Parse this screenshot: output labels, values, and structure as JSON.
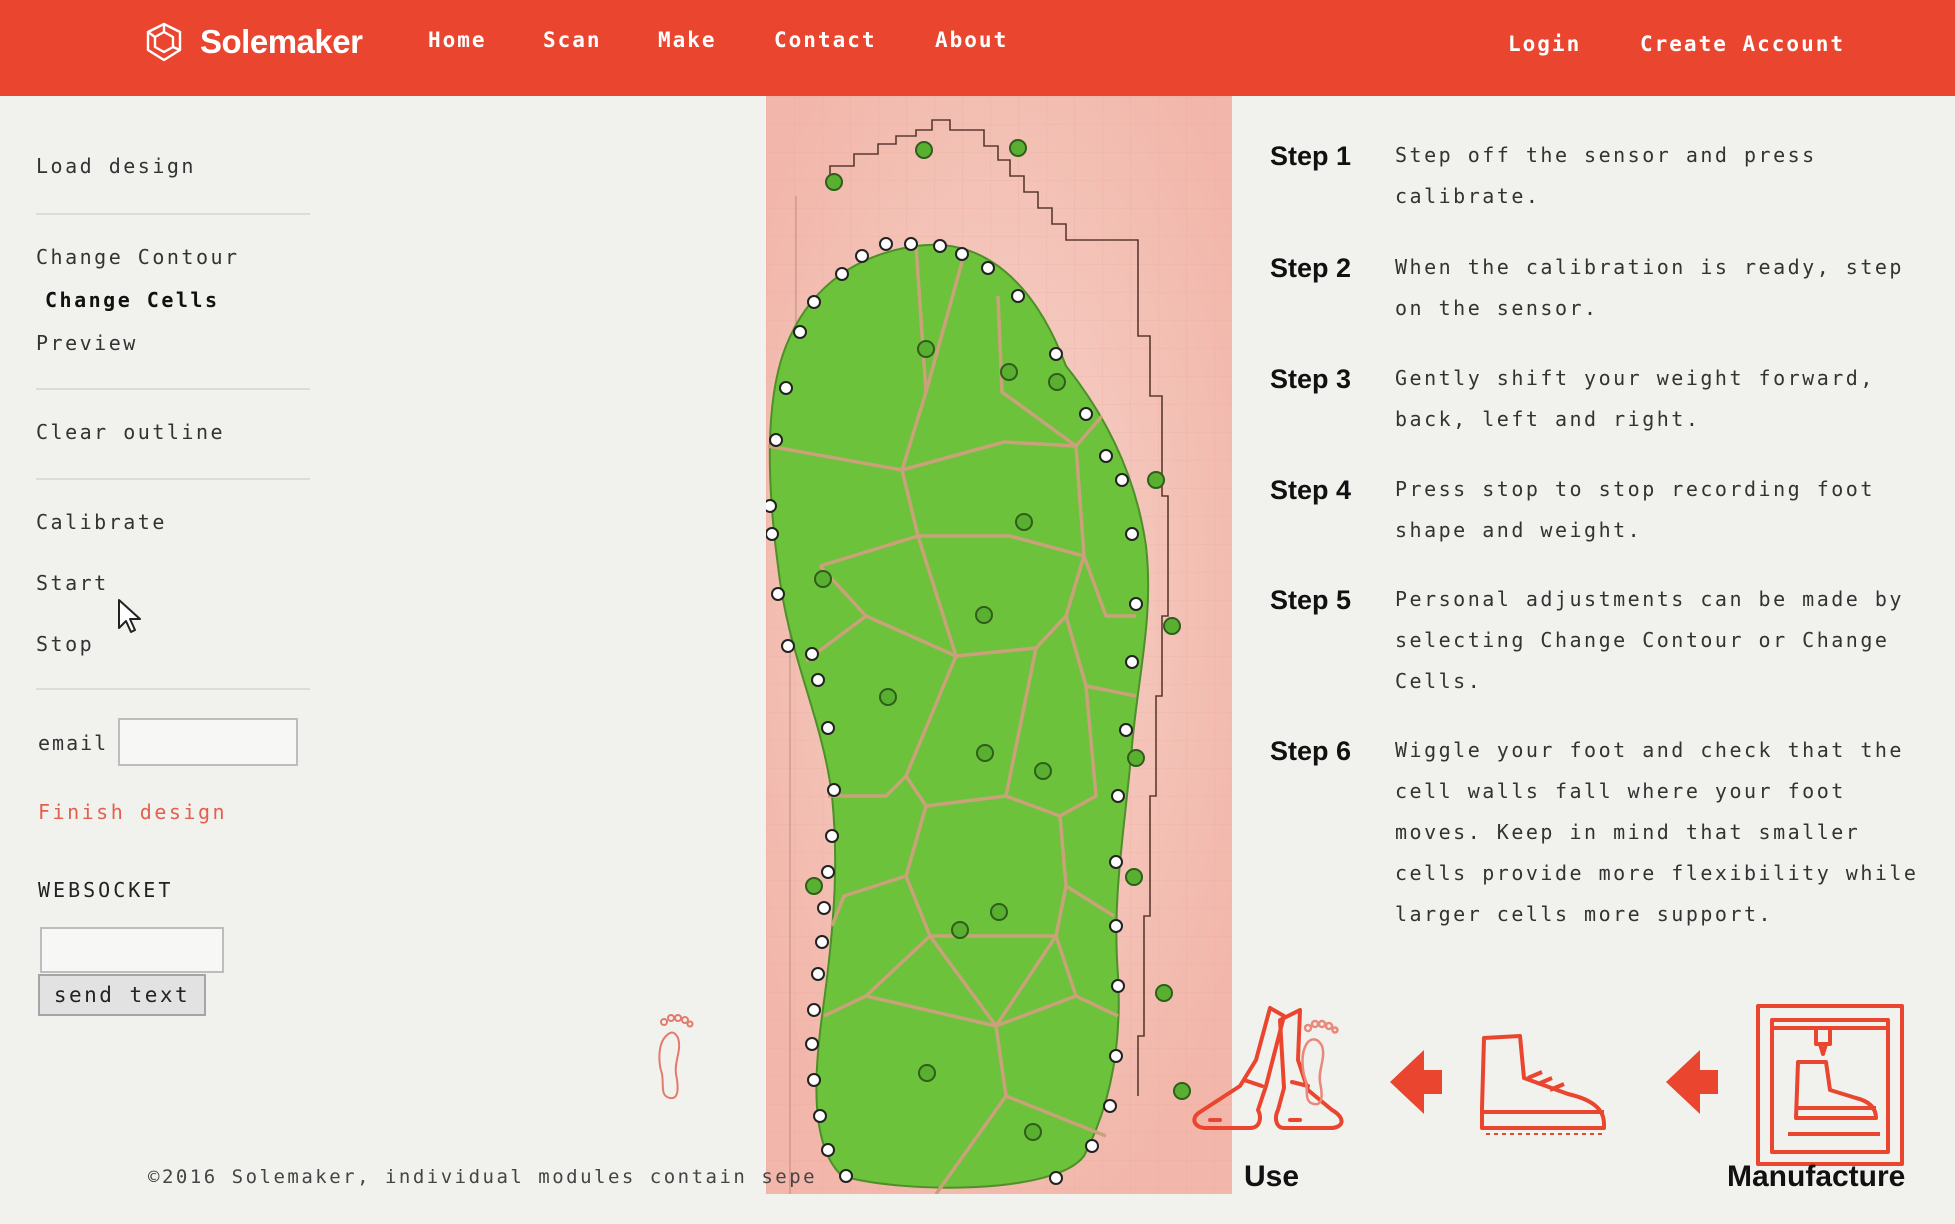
{
  "header": {
    "brand": "Solemaker",
    "nav": [
      "Home",
      "Scan",
      "Make",
      "Contact",
      "About"
    ],
    "auth": [
      "Login",
      "Create Account"
    ]
  },
  "sidebar": {
    "load_design": "Load design",
    "change_contour": "Change Contour",
    "change_cells": "Change Cells",
    "preview": "Preview",
    "clear_outline": "Clear outline",
    "calibrate": "Calibrate",
    "start": "Start",
    "stop": "Stop",
    "email_label": "email",
    "email_value": "",
    "finish_design": "Finish design",
    "websocket_title": "WEBSOCKET",
    "websocket_value": "",
    "send_button": "send text"
  },
  "steps": [
    {
      "label": "Step 1",
      "text": "Step off the sensor and press calibrate."
    },
    {
      "label": "Step 2",
      "text": "When the calibration is ready, step on the sensor."
    },
    {
      "label": "Step 3",
      "text": "Gently shift your weight forward, back, left and right."
    },
    {
      "label": "Step 4",
      "text": "Press stop to stop recording foot shape and weight."
    },
    {
      "label": "Step 5",
      "text": "Personal adjustments can be made by selecting Change Contour or Change Cells."
    },
    {
      "label": "Step 6",
      "text": "Wiggle your foot and check that the cell walls fall where your foot moves. Keep in mind that smaller cells provide more flexibility while larger cells more support."
    }
  ],
  "process": {
    "use": "Use",
    "manufacture": "Manufacture"
  },
  "footer": "©2016 Solemaker, individual modules contain sepe",
  "colors": {
    "brand": "#e9452f",
    "sole": "#6cc23a",
    "cell_walls": "#c9a27a",
    "heatmap": "#f3c2b8"
  }
}
